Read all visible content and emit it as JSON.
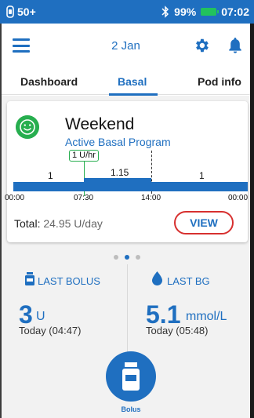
{
  "status": {
    "pod_indicator": "50+",
    "battery_percent": "99%",
    "time": "07:02",
    "icons": [
      "pod-icon",
      "bluetooth-icon",
      "battery-icon"
    ]
  },
  "header": {
    "date": "2 Jan",
    "icons": [
      "menu-icon",
      "gear-icon",
      "bell-icon"
    ]
  },
  "tabs": {
    "dashboard": "Dashboard",
    "basal": "Basal",
    "pod_info": "Pod info",
    "active": "Basal"
  },
  "card": {
    "program_name": "Weekend",
    "program_status": "Active Basal Program",
    "current_rate_tag": "1 U/hr",
    "segments": [
      {
        "rate": "1"
      },
      {
        "rate": "1.15"
      },
      {
        "rate": "1"
      }
    ],
    "ticks": [
      "00:00",
      "07:30",
      "14:00",
      "00:00"
    ],
    "total_label": "Total:",
    "total_value": "24.95 U/day",
    "view_button": "VIEW"
  },
  "pager": {
    "count": 3,
    "active_index": 1
  },
  "last_bolus": {
    "label": "LAST BOLUS",
    "value": "3",
    "unit": "U",
    "time": "Today (04:47)"
  },
  "last_bg": {
    "label": "LAST BG",
    "value": "5.1",
    "unit": "mmol/L",
    "time": "Today (05:48)"
  },
  "bolus_button": {
    "label": "Bolus"
  },
  "colors": {
    "primary": "#1f6fc0",
    "active_green": "#27ae4f",
    "view_border": "#d7302f",
    "battery": "#22c25d"
  }
}
